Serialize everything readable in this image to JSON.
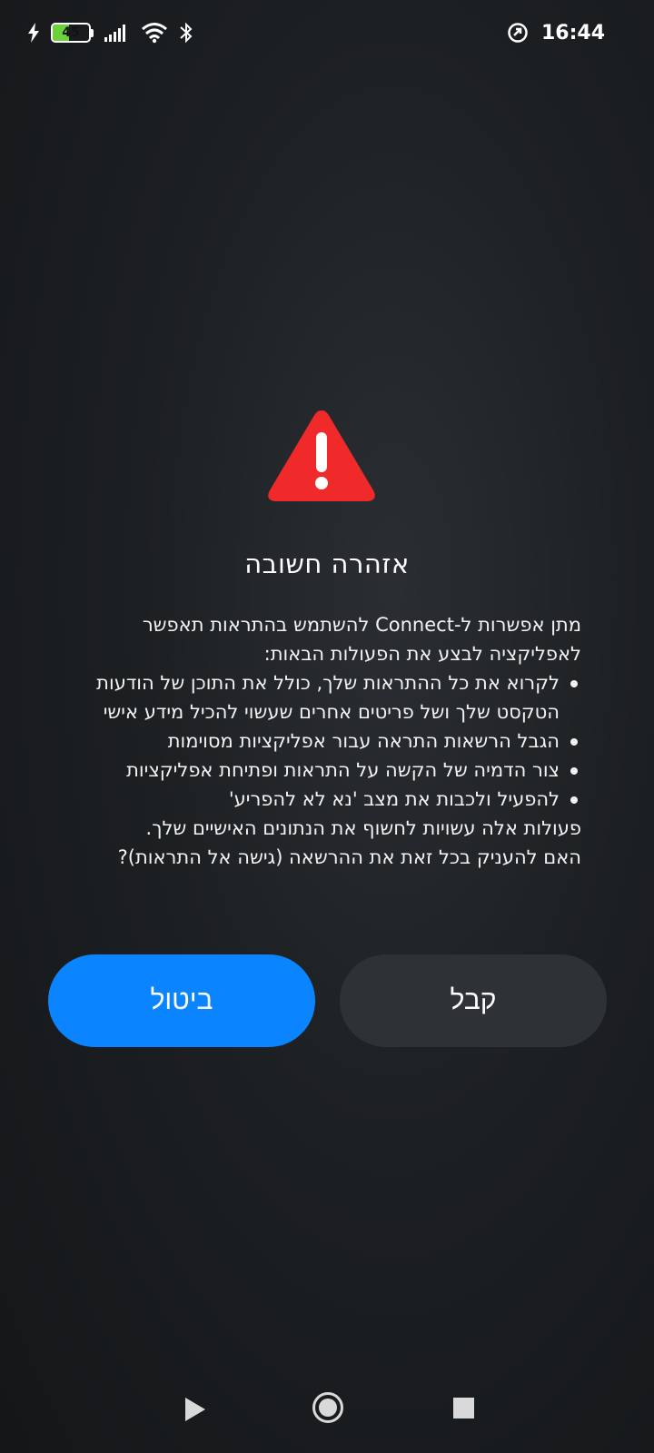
{
  "status_bar": {
    "battery_level": "45",
    "battery_fraction": 0.45,
    "time": "16:44",
    "icons": [
      "charging-icon",
      "battery-icon",
      "signal-icon",
      "wifi-icon",
      "bluetooth-icon",
      "data-saver-icon"
    ]
  },
  "dialog": {
    "icon": "warning-triangle-icon",
    "title": "אזהרה חשובה",
    "intro": "מתן אפשרות ל-Connect להשתמש בהתראות תאפשר לאפליקציה לבצע את הפעולות הבאות:",
    "bullets": [
      "לקרוא את כל ההתראות שלך, כולל את התוכן של הודעות הטקסט שלך ושל פריטים אחרים שעשוי להכיל מידע אישי",
      "הגבל הרשאות התראה עבור אפליקציות מסוימות",
      "צור הדמיה של הקשה על התראות ופתיחת אפליקציות",
      "להפעיל ולכבות את מצב 'נא לא להפריע'"
    ],
    "outro_1": "פעולות אלה עשויות לחשוף את הנתונים האישיים שלך.",
    "outro_2": "האם להעניק בכל זאת את ההרשאה (גישה אל התראות)?"
  },
  "buttons": {
    "cancel_label": "ביטול",
    "accept_label": "קבל"
  },
  "colors": {
    "warning": "#f02a2a",
    "cancel_button": "#0a84ff",
    "accept_button": "#2e3236",
    "battery_fill": "#6cd13a"
  },
  "nav_bar": {
    "icons": [
      "back-icon",
      "home-icon",
      "recents-icon"
    ]
  }
}
